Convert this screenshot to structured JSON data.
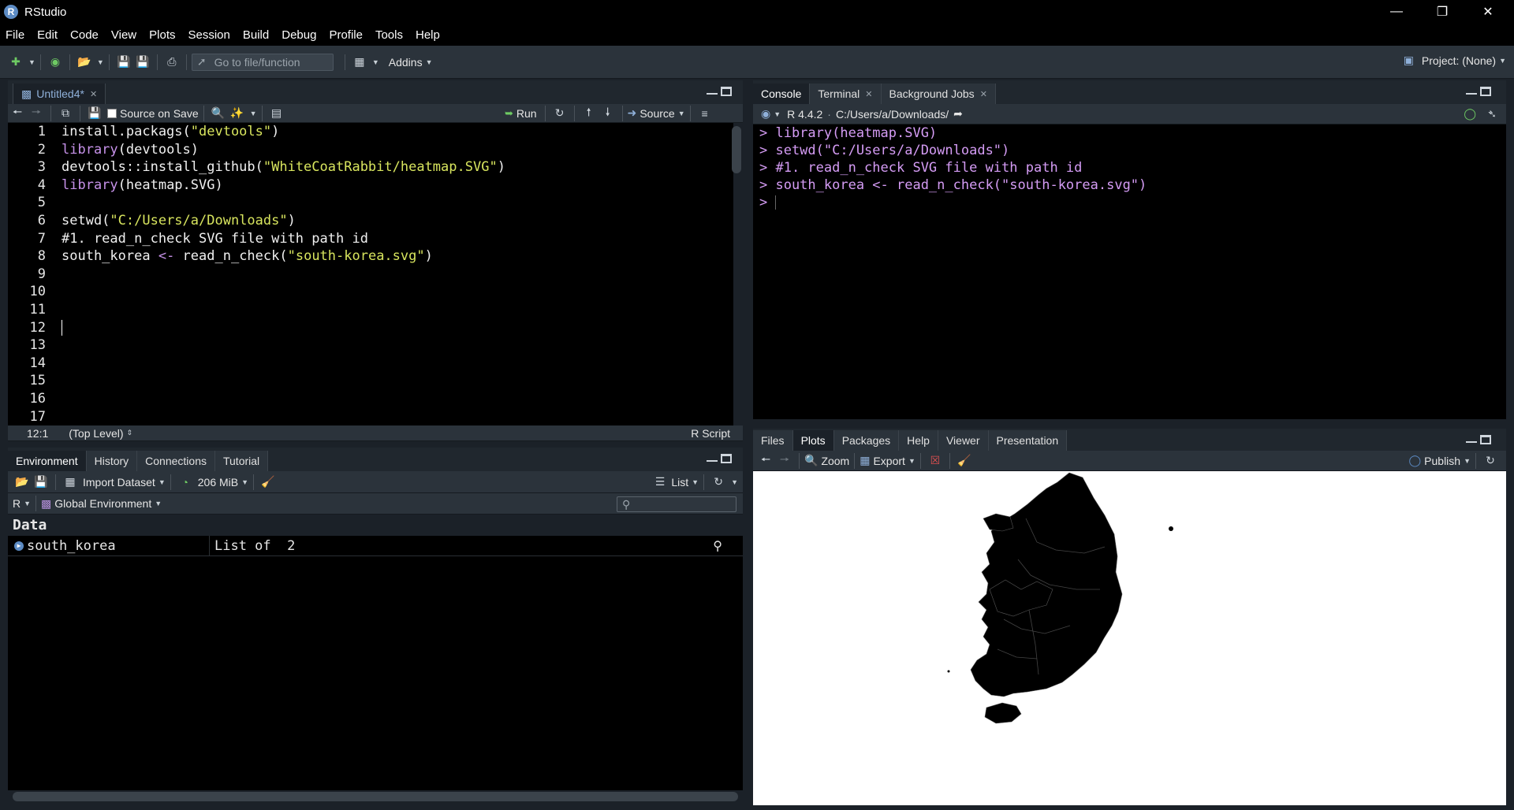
{
  "window": {
    "title": "RStudio",
    "logo": "R"
  },
  "menu": [
    "File",
    "Edit",
    "Code",
    "View",
    "Plots",
    "Session",
    "Build",
    "Debug",
    "Profile",
    "Tools",
    "Help"
  ],
  "toolbar": {
    "goto_placeholder": "Go to file/function",
    "addins": "Addins",
    "project": "Project: (None)"
  },
  "editor": {
    "tab": "Untitled4*",
    "source_on_save": "Source on Save",
    "run": "Run",
    "source": "Source",
    "lines": [
      "install.packags(\"devtools\")",
      "library(devtools)",
      "devtools::install_github(\"WhiteCoatRabbit/heatmap.SVG\")",
      "library(heatmap.SVG)",
      "",
      "setwd(\"C:/Users/a/Downloads\")",
      "#1. read_n_check SVG file with path id",
      "south_korea <- read_n_check(\"south-korea.svg\")",
      "",
      "",
      "",
      "",
      "",
      "",
      "",
      "",
      ""
    ],
    "status_pos": "12:1",
    "status_scope": "(Top Level)",
    "status_type": "R Script"
  },
  "console": {
    "tabs": [
      "Console",
      "Terminal",
      "Background Jobs"
    ],
    "r_version": "R 4.4.2",
    "path": "C:/Users/a/Downloads/",
    "lines": [
      "> library(heatmap.SVG)",
      "> setwd(\"C:/Users/a/Downloads\")",
      "> #1. read_n_check SVG file with path id",
      "> south_korea <- read_n_check(\"south-korea.svg\")",
      "> "
    ]
  },
  "environment": {
    "tabs": [
      "Environment",
      "History",
      "Connections",
      "Tutorial"
    ],
    "import_dataset": "Import Dataset",
    "memory": "206 MiB",
    "view_mode": "List",
    "language": "R",
    "scope": "Global Environment",
    "section": "Data",
    "rows": [
      {
        "name": "south_korea",
        "value": "List of  2"
      }
    ]
  },
  "files_pane": {
    "tabs": [
      "Files",
      "Plots",
      "Packages",
      "Help",
      "Viewer",
      "Presentation"
    ],
    "zoom": "Zoom",
    "export": "Export",
    "publish": "Publish"
  }
}
